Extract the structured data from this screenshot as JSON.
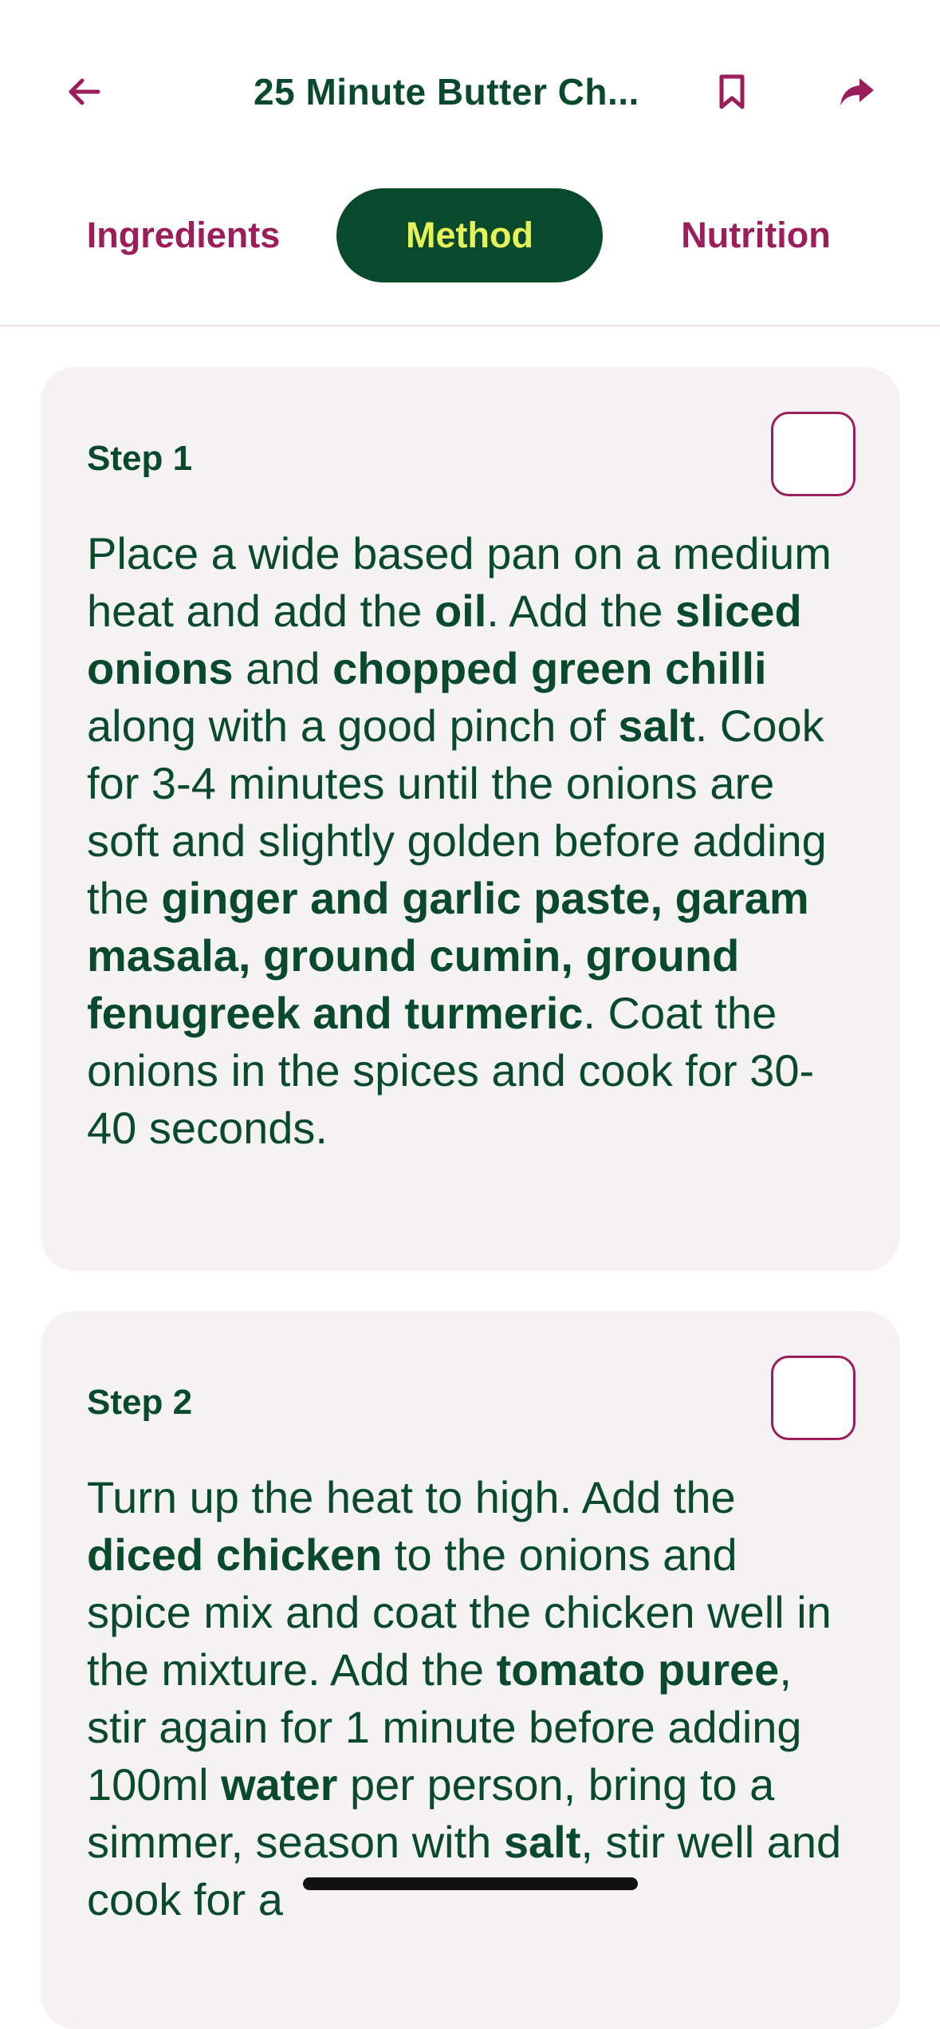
{
  "header": {
    "title": "25 Minute Butter Ch...",
    "back_icon": "arrow-left-icon",
    "bookmark_icon": "bookmark-icon",
    "share_icon": "share-icon"
  },
  "tabs": [
    {
      "label": "Ingredients",
      "active": false
    },
    {
      "label": "Method",
      "active": true
    },
    {
      "label": "Nutrition",
      "active": false
    }
  ],
  "colors": {
    "brand_green": "#0a4a2c",
    "accent_pink": "#9b1d5a",
    "active_tab_text": "#e6f25a",
    "card_bg": "#f4f2f3"
  },
  "steps": [
    {
      "label": "Step 1",
      "checked": false,
      "segments": [
        {
          "t": "Place a wide based pan on a medium heat and add the ",
          "b": false
        },
        {
          "t": "oil",
          "b": true
        },
        {
          "t": ".  Add the ",
          "b": false
        },
        {
          "t": "sliced onions",
          "b": true
        },
        {
          "t": " and ",
          "b": false
        },
        {
          "t": "chopped green chilli",
          "b": true
        },
        {
          "t": " along with a good pinch of ",
          "b": false
        },
        {
          "t": "salt",
          "b": true
        },
        {
          "t": ".  Cook for 3-4 minutes until the onions are soft and slightly golden before adding the ",
          "b": false
        },
        {
          "t": "ginger and garlic paste, garam masala, ground cumin, ground fenugreek and turmeric",
          "b": true
        },
        {
          "t": ".  Coat the onions in the spices and cook for 30-40 seconds.",
          "b": false
        }
      ]
    },
    {
      "label": "Step 2",
      "checked": false,
      "segments": [
        {
          "t": "Turn up the heat to high.  Add the ",
          "b": false
        },
        {
          "t": "diced chicken",
          "b": true
        },
        {
          "t": " to the onions and spice mix and coat the chicken well in the mixture.  Add the ",
          "b": false
        },
        {
          "t": "tomato puree",
          "b": true
        },
        {
          "t": ", stir again for 1 minute before adding 100ml ",
          "b": false
        },
        {
          "t": "water",
          "b": true
        },
        {
          "t": " per person, bring to a simmer, season with ",
          "b": false
        },
        {
          "t": "salt",
          "b": true
        },
        {
          "t": ", stir well and cook for a",
          "b": false
        }
      ]
    }
  ]
}
